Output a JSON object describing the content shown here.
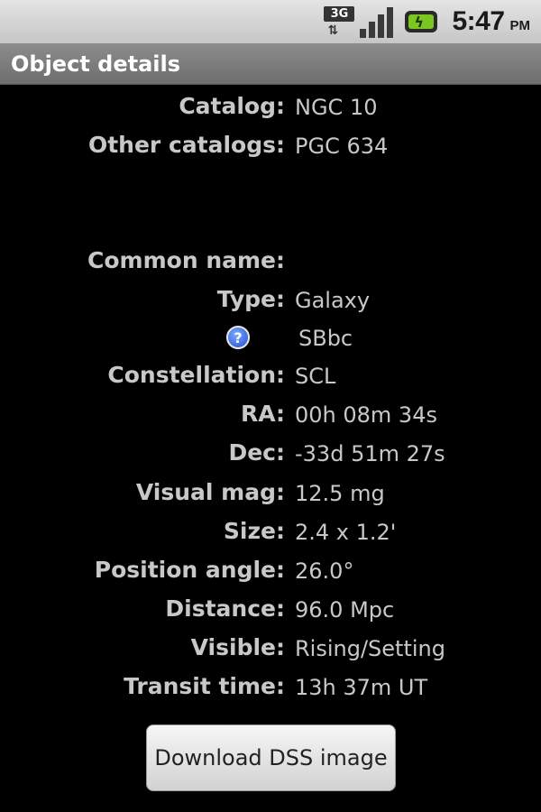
{
  "status_bar": {
    "network_type": "3G",
    "network_arrows": "⇅",
    "time": "5:47",
    "ampm": "PM"
  },
  "header": {
    "title": "Object details"
  },
  "details": [
    {
      "label": "Catalog:",
      "value": "NGC 10"
    },
    {
      "label": "Other catalogs:",
      "value": "PGC 634"
    },
    {
      "label": "Common name:",
      "value": ""
    },
    {
      "label": "Type:",
      "value": "Galaxy"
    },
    {
      "label": "",
      "value": "SBbc"
    },
    {
      "label": "Constellation:",
      "value": "SCL"
    },
    {
      "label": "RA:",
      "value": "00h 08m 34s"
    },
    {
      "label": "Dec:",
      "value": "-33d 51m 27s"
    },
    {
      "label": "Visual mag:",
      "value": "12.5 mg"
    },
    {
      "label": "Size:",
      "value": "2.4 x 1.2'"
    },
    {
      "label": "Position angle:",
      "value": "26.0°"
    },
    {
      "label": "Distance:",
      "value": "96.0 Mpc"
    },
    {
      "label": "Visible:",
      "value": "Rising/Setting"
    },
    {
      "label": "Transit time:",
      "value": "13h 37m UT"
    }
  ],
  "help_icon": {
    "glyph": "?",
    "name": "help-icon"
  },
  "download_button": {
    "label": "Download DSS image"
  },
  "colors": {
    "background": "#000000",
    "text": "#c8c8c8",
    "title_bar": "#7a7a7a",
    "battery_fill": "#7bc620"
  }
}
